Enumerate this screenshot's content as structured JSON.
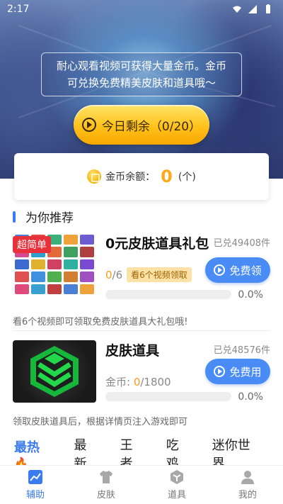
{
  "status_bar": {
    "time": "2:17"
  },
  "hero": {
    "notice": "耐心观看视频可获得大量金币。金币可兑换免费精美皮肤和道具哦～",
    "today_button": "今日剩余（0/20）"
  },
  "balance": {
    "label": "金币余额：",
    "value": "0",
    "unit": "(个)"
  },
  "section": {
    "title": "为你推荐"
  },
  "cards": [
    {
      "badge": "超简单",
      "title": "0元皮肤道具礼包",
      "claimed": "已兑49408件",
      "action": "免费领",
      "progress_current": "0",
      "progress_total": "/6",
      "tag": "看6个视频领取",
      "percent": "0.0%",
      "progress_fraction": 0,
      "desc": "看6个视频即可领取免费皮肤道具大礼包哦!"
    },
    {
      "title": "皮肤道具",
      "claimed": "已兑48576件",
      "action": "免费用",
      "progress_label": "金币: ",
      "progress_current": "0",
      "progress_total": "/1800",
      "percent": "0.0%",
      "progress_fraction": 0,
      "desc": "领取皮肤道具后，根据详情页注入游戏即可"
    }
  ],
  "tabs": [
    "最热",
    "最新",
    "王者",
    "吃鸡",
    "迷你世界"
  ],
  "bottom_nav": [
    "辅助",
    "皮肤",
    "道具",
    "我的"
  ],
  "colors": {
    "accent": "#3a7bef",
    "coin": "#ffa91a",
    "badge": "#e8313a"
  }
}
